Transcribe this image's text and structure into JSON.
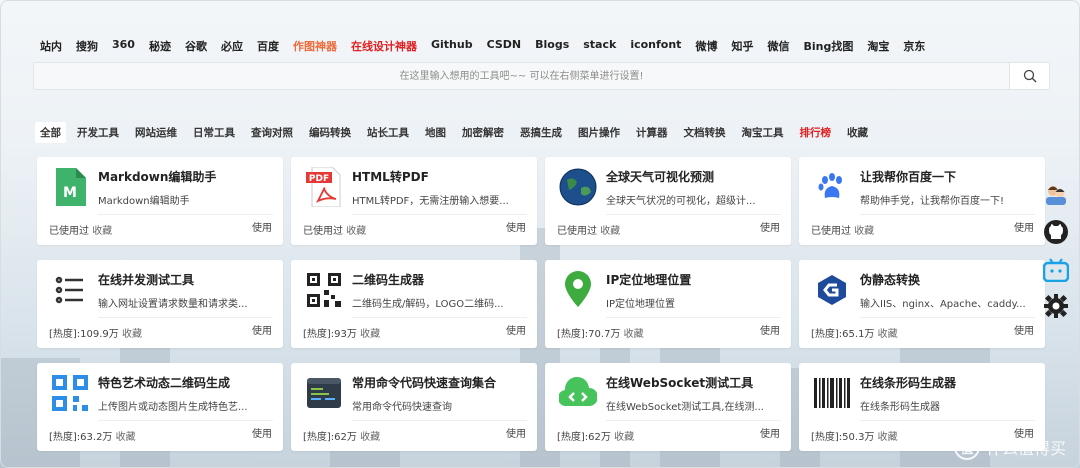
{
  "engines": [
    {
      "label": "站内",
      "style": ""
    },
    {
      "label": "搜狗",
      "style": ""
    },
    {
      "label": "360",
      "style": ""
    },
    {
      "label": "秘迹",
      "style": ""
    },
    {
      "label": "谷歌",
      "style": ""
    },
    {
      "label": "必应",
      "style": ""
    },
    {
      "label": "百度",
      "style": ""
    },
    {
      "label": "作图神器",
      "style": "orange"
    },
    {
      "label": "在线设计神器",
      "style": "red"
    },
    {
      "label": "Github",
      "style": ""
    },
    {
      "label": "CSDN",
      "style": ""
    },
    {
      "label": "Blogs",
      "style": ""
    },
    {
      "label": "stack",
      "style": ""
    },
    {
      "label": "iconfont",
      "style": ""
    },
    {
      "label": "微博",
      "style": ""
    },
    {
      "label": "知乎",
      "style": ""
    },
    {
      "label": "微信",
      "style": ""
    },
    {
      "label": "Bing找图",
      "style": ""
    },
    {
      "label": "淘宝",
      "style": ""
    },
    {
      "label": "京东",
      "style": ""
    }
  ],
  "search": {
    "placeholder": "在这里输入想用的工具吧~~ 可以在右侧菜单进行设置!",
    "icon": "search-icon"
  },
  "tabs": [
    {
      "label": "全部",
      "style": "active"
    },
    {
      "label": "开发工具",
      "style": ""
    },
    {
      "label": "网站运维",
      "style": ""
    },
    {
      "label": "日常工具",
      "style": ""
    },
    {
      "label": "查询对照",
      "style": ""
    },
    {
      "label": "编码转换",
      "style": ""
    },
    {
      "label": "站长工具",
      "style": ""
    },
    {
      "label": "地图",
      "style": ""
    },
    {
      "label": "加密解密",
      "style": ""
    },
    {
      "label": "恶搞生成",
      "style": ""
    },
    {
      "label": "图片操作",
      "style": ""
    },
    {
      "label": "计算器",
      "style": ""
    },
    {
      "label": "文档转换",
      "style": ""
    },
    {
      "label": "淘宝工具",
      "style": ""
    },
    {
      "label": "排行榜",
      "style": "red"
    },
    {
      "label": "收藏",
      "style": ""
    }
  ],
  "cards": [
    {
      "title": "Markdown编辑助手",
      "desc": "Markdown编辑助手",
      "meta": "已使用过",
      "fav": "收藏",
      "use": "使用",
      "icon": "markdown-icon"
    },
    {
      "title": "HTML转PDF",
      "desc": "HTML转PDF，无需注册输入想要...",
      "meta": "已使用过",
      "fav": "收藏",
      "use": "使用",
      "icon": "pdf-icon"
    },
    {
      "title": "全球天气可视化预测",
      "desc": "全球天气状况的可视化，超级计...",
      "meta": "已使用过",
      "fav": "收藏",
      "use": "使用",
      "icon": "globe-icon"
    },
    {
      "title": "让我帮你百度一下",
      "desc": "帮助伸手党，让我帮你百度一下!",
      "meta": "已使用过",
      "fav": "收藏",
      "use": "使用",
      "icon": "baidu-paw-icon"
    },
    {
      "title": "在线并发测试工具",
      "desc": "输入网址设置请求数量和请求类...",
      "meta": "[热度]:109.9万",
      "fav": "收藏",
      "use": "使用",
      "icon": "list-icon"
    },
    {
      "title": "二维码生成器",
      "desc": "二维码生成/解码，LOGO二维码...",
      "meta": "[热度]:93万",
      "fav": "收藏",
      "use": "使用",
      "icon": "qrcode-icon"
    },
    {
      "title": "IP定位地理位置",
      "desc": "IP定位地理位置",
      "meta": "[热度]:70.7万",
      "fav": "收藏",
      "use": "使用",
      "icon": "location-pin-icon"
    },
    {
      "title": "伪静态转换",
      "desc": "输入IIS、nginx、Apache、caddy...",
      "meta": "[热度]:65.1万",
      "fav": "收藏",
      "use": "使用",
      "icon": "g-logo-icon"
    },
    {
      "title": "特色艺术动态二维码生成",
      "desc": "上传图片或动态图片生成特色艺...",
      "meta": "[热度]:63.2万",
      "fav": "收藏",
      "use": "使用",
      "icon": "art-qrcode-icon"
    },
    {
      "title": "常用命令代码快速查询集合",
      "desc": "常用命令代码快速查询",
      "meta": "[热度]:62万",
      "fav": "收藏",
      "use": "使用",
      "icon": "terminal-icon"
    },
    {
      "title": "在线WebSocket测试工具",
      "desc": "在线WebSocket测试工具,在线测...",
      "meta": "[热度]:62万",
      "fav": "收藏",
      "use": "使用",
      "icon": "websocket-icon"
    },
    {
      "title": "在线条形码生成器",
      "desc": "在线条形码生成器",
      "meta": "[热度]:50.3万",
      "fav": "收藏",
      "use": "使用",
      "icon": "barcode-icon"
    }
  ],
  "side_icons": [
    "users-icon",
    "github-icon",
    "bilibili-icon",
    "gear-icon"
  ],
  "watermark": {
    "mark": "值",
    "text": "什么值得买"
  },
  "colors": {
    "red": "#e01f1f",
    "orange": "#ef6a3a",
    "markdown_green": "#3fb36b",
    "pdf_red": "#e53935",
    "baidu_blue": "#3a78f2",
    "pin_green": "#3dab3e",
    "ws_green": "#46c35a",
    "qr_blue": "#2c8ee8"
  }
}
